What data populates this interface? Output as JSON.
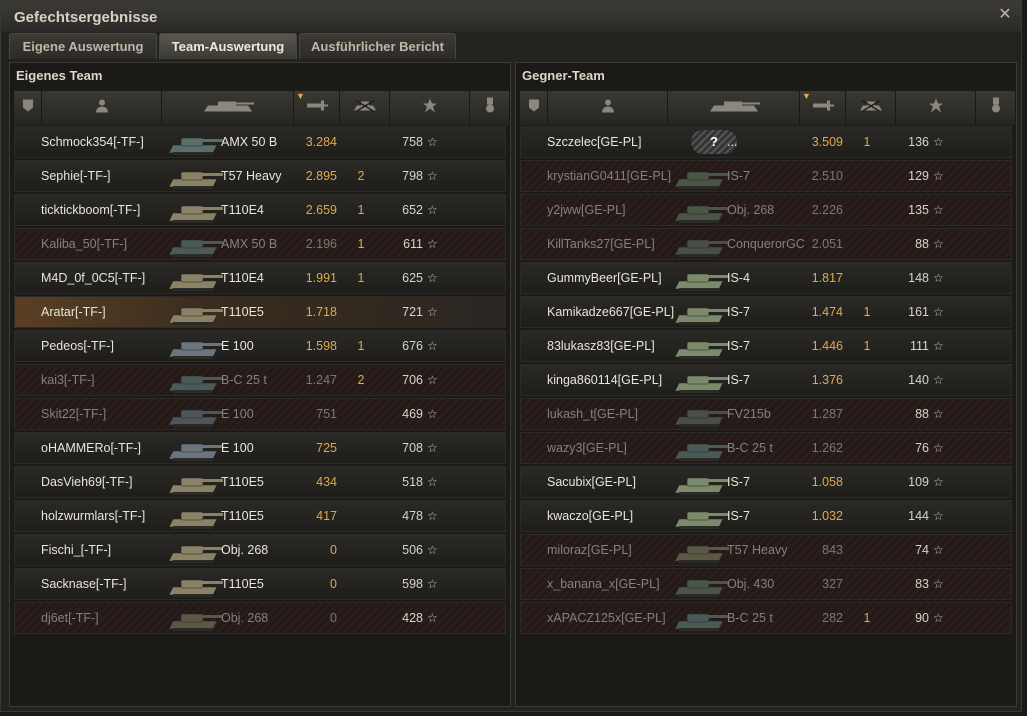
{
  "window": {
    "title": "Gefechtsergebnisse",
    "close_icon": "close-icon"
  },
  "tabs": [
    {
      "label": "Eigene Auswertung",
      "active": false
    },
    {
      "label": "Team-Auswertung",
      "active": true
    },
    {
      "label": "Ausführlicher Bericht",
      "active": false
    }
  ],
  "columns": [
    "rank-icon",
    "player-icon",
    "tank-icon",
    "damage-icon",
    "kills-icon",
    "xp-icon",
    "medal-icon"
  ],
  "own_team": {
    "title": "Eigenes Team",
    "rows": [
      {
        "name": "Schmock354[-TF-]",
        "tank": "AMX 50 B",
        "damage": "3.284",
        "kills": "",
        "xp": "758",
        "dead": false,
        "me": false,
        "tank_color": "#5b6e6a"
      },
      {
        "name": "Sephie[-TF-]",
        "tank": "T57 Heavy",
        "damage": "2.895",
        "kills": "2",
        "xp": "798",
        "dead": false,
        "me": false,
        "tank_color": "#8a8266"
      },
      {
        "name": "ticktickboom[-TF-]",
        "tank": "T110E4",
        "damage": "2.659",
        "kills": "1",
        "xp": "652",
        "dead": false,
        "me": false,
        "tank_color": "#8a8266"
      },
      {
        "name": "Kaliba_50[-TF-]",
        "tank": "AMX 50 B",
        "damage": "2.196",
        "kills": "1",
        "xp": "611",
        "dead": true,
        "me": false,
        "tank_color": "#4b5a57"
      },
      {
        "name": "M4D_0f_0C5[-TF-]",
        "tank": "T110E4",
        "damage": "1.991",
        "kills": "1",
        "xp": "625",
        "dead": false,
        "me": false,
        "tank_color": "#8a8266"
      },
      {
        "name": "Aratar[-TF-]",
        "tank": "T110E5",
        "damage": "1.718",
        "kills": "",
        "xp": "721",
        "dead": false,
        "me": true,
        "tank_color": "#8a8266"
      },
      {
        "name": "Pedeos[-TF-]",
        "tank": "E 100",
        "damage": "1.598",
        "kills": "1",
        "xp": "676",
        "dead": false,
        "me": false,
        "tank_color": "#6b7580"
      },
      {
        "name": "kai3[-TF-]",
        "tank": "B-C 25 t",
        "damage": "1.247",
        "kills": "2",
        "xp": "706",
        "dead": true,
        "me": false,
        "tank_color": "#4b5a57"
      },
      {
        "name": "Skit22[-TF-]",
        "tank": "E 100",
        "damage": "751",
        "kills": "",
        "xp": "469",
        "dead": true,
        "me": false,
        "tank_color": "#4e555c"
      },
      {
        "name": "oHAMMERo[-TF-]",
        "tank": "E 100",
        "damage": "725",
        "kills": "",
        "xp": "708",
        "dead": false,
        "me": false,
        "tank_color": "#6b7580"
      },
      {
        "name": "DasVieh69[-TF-]",
        "tank": "T110E5",
        "damage": "434",
        "kills": "",
        "xp": "518",
        "dead": false,
        "me": false,
        "tank_color": "#8a8266"
      },
      {
        "name": "holzwurmlars[-TF-]",
        "tank": "T110E5",
        "damage": "417",
        "kills": "",
        "xp": "478",
        "dead": false,
        "me": false,
        "tank_color": "#8a8266"
      },
      {
        "name": "Fischi_[-TF-]",
        "tank": "Obj. 268",
        "damage": "0",
        "kills": "",
        "xp": "506",
        "dead": false,
        "me": false,
        "tank_color": "#8a8266"
      },
      {
        "name": "Sacknase[-TF-]",
        "tank": "T110E5",
        "damage": "0",
        "kills": "",
        "xp": "598",
        "dead": false,
        "me": false,
        "tank_color": "#8a8266"
      },
      {
        "name": "dj6et[-TF-]",
        "tank": "Obj. 268",
        "damage": "0",
        "kills": "",
        "xp": "428",
        "dead": true,
        "me": false,
        "tank_color": "#5c5846"
      }
    ]
  },
  "enemy_team": {
    "title": "Gegner-Team",
    "rows": [
      {
        "name": "Szczelec[GE-PL]",
        "tank": "...",
        "damage": "3.509",
        "kills": "1",
        "xp": "136",
        "dead": false,
        "me": false,
        "unknown": true,
        "unknown_label": "?",
        "tank_color": "#555555"
      },
      {
        "name": "krystianG0411[GE-PL]",
        "tank": "IS-7",
        "damage": "2.510",
        "kills": "",
        "xp": "129",
        "dead": true,
        "me": false,
        "tank_color": "#4a5546"
      },
      {
        "name": "y2jww[GE-PL]",
        "tank": "Obj. 268",
        "damage": "2.226",
        "kills": "",
        "xp": "135",
        "dead": true,
        "me": false,
        "tank_color": "#4a5546"
      },
      {
        "name": "KillTanks27[GE-PL]",
        "tank": "ConquerorGC",
        "damage": "2.051",
        "kills": "",
        "xp": "88",
        "dead": true,
        "me": false,
        "tank_color": "#4a4e48"
      },
      {
        "name": "GummyBeer[GE-PL]",
        "tank": "IS-4",
        "damage": "1.817",
        "kills": "",
        "xp": "148",
        "dead": false,
        "me": false,
        "tank_color": "#7a8a6a"
      },
      {
        "name": "Kamikadze667[GE-PL]",
        "tank": "IS-7",
        "damage": "1.474",
        "kills": "1",
        "xp": "161",
        "dead": false,
        "me": false,
        "tank_color": "#7a8a6a"
      },
      {
        "name": "83lukasz83[GE-PL]",
        "tank": "IS-7",
        "damage": "1.446",
        "kills": "1",
        "xp": "111",
        "dead": false,
        "me": false,
        "tank_color": "#7a8a6a"
      },
      {
        "name": "kinga860114[GE-PL]",
        "tank": "IS-7",
        "damage": "1.376",
        "kills": "",
        "xp": "140",
        "dead": false,
        "me": false,
        "tank_color": "#7a8a6a"
      },
      {
        "name": "lukash_t[GE-PL]",
        "tank": "FV215b",
        "damage": "1.287",
        "kills": "",
        "xp": "88",
        "dead": true,
        "me": false,
        "tank_color": "#4a4e48"
      },
      {
        "name": "wazy3[GE-PL]",
        "tank": "B-C 25 t",
        "damage": "1.262",
        "kills": "",
        "xp": "76",
        "dead": true,
        "me": false,
        "tank_color": "#4b5a57"
      },
      {
        "name": "Sacubix[GE-PL]",
        "tank": "IS-7",
        "damage": "1.058",
        "kills": "",
        "xp": "109",
        "dead": false,
        "me": false,
        "tank_color": "#7a8a6a"
      },
      {
        "name": "kwaczo[GE-PL]",
        "tank": "IS-7",
        "damage": "1.032",
        "kills": "",
        "xp": "144",
        "dead": false,
        "me": false,
        "tank_color": "#7a8a6a"
      },
      {
        "name": "miloraz[GE-PL]",
        "tank": "T57 Heavy",
        "damage": "843",
        "kills": "",
        "xp": "74",
        "dead": true,
        "me": false,
        "tank_color": "#5c5846"
      },
      {
        "name": "x_banana_x[GE-PL]",
        "tank": "Obj. 430",
        "damage": "327",
        "kills": "",
        "xp": "83",
        "dead": true,
        "me": false,
        "tank_color": "#4a5546"
      },
      {
        "name": "xAPACZ125x[GE-PL]",
        "tank": "B-C 25 t",
        "damage": "282",
        "kills": "1",
        "xp": "90",
        "dead": true,
        "me": false,
        "tank_color": "#4b5a57"
      }
    ]
  }
}
